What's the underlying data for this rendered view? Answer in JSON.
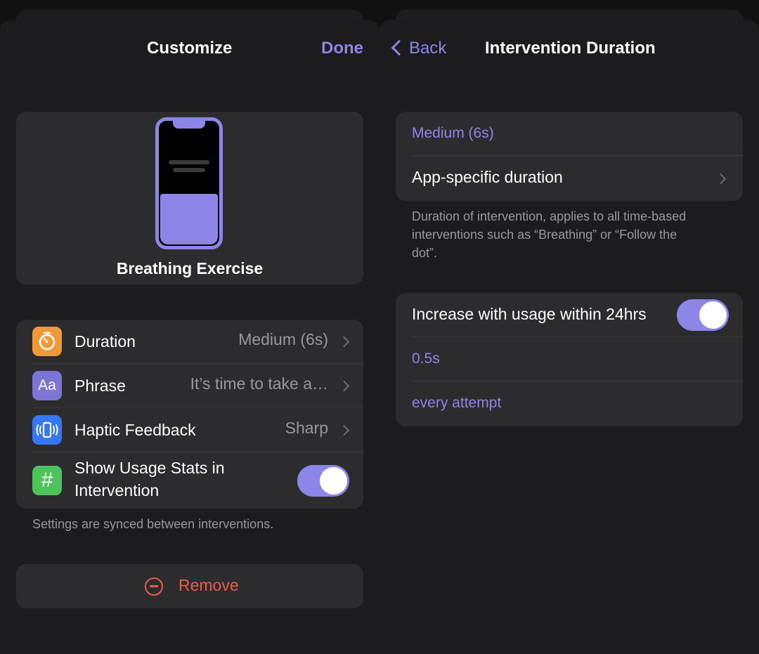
{
  "left": {
    "title": "Customize",
    "done_label": "Done",
    "preview": {
      "label": "Breathing Exercise"
    },
    "settings": {
      "duration": {
        "label": "Duration",
        "value": "Medium (6s)",
        "icon": "timer-icon",
        "color": "#f09a37"
      },
      "phrase": {
        "label": "Phrase",
        "value": "It’s time to take a…",
        "icon": "text-aa-icon",
        "icon_text": "Aa",
        "color": "#7d74d6"
      },
      "haptic": {
        "label": "Haptic Feedback",
        "value": "Sharp",
        "icon": "haptic-vibration-icon",
        "color": "#3478f6"
      },
      "usage_stats": {
        "label_line1": "Show Usage Stats in",
        "label_line2": "Intervention",
        "enabled": true,
        "icon": "hashtag-icon",
        "icon_text": "#",
        "color": "#4cc35b"
      }
    },
    "footnote": "Settings are synced between interventions.",
    "remove_label": "Remove"
  },
  "right": {
    "back_label": "Back",
    "title": "Intervention Duration",
    "selected_duration": "Medium (6s)",
    "app_specific_label": "App-specific duration",
    "footnote_line1": "Duration of intervention, applies to all time-based",
    "footnote_line2": "interventions such as “Breathing” or “Follow the",
    "footnote_line3": "dot”.",
    "increase": {
      "label": "Increase with usage within 24hrs",
      "enabled": true,
      "amount": "0.5s",
      "frequency": "every attempt"
    }
  },
  "colors": {
    "accent": "#8d86e8",
    "destructive": "#ec5a4b",
    "card": "#2c2c2e",
    "sheet": "#1c1c1e"
  }
}
